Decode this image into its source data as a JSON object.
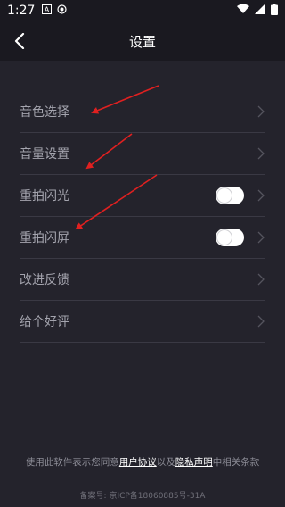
{
  "status_bar": {
    "time": "1:27",
    "left_icons": [
      "a-box-icon",
      "circle-dot-icon"
    ],
    "right_icons": [
      "wifi-icon",
      "signal-icon",
      "battery-icon"
    ]
  },
  "header": {
    "title": "设置"
  },
  "settings": {
    "items": [
      {
        "label": "音色选择",
        "toggle": null
      },
      {
        "label": "音量设置",
        "toggle": null
      },
      {
        "label": "重拍闪光",
        "toggle": false
      },
      {
        "label": "重拍闪屏",
        "toggle": false
      },
      {
        "label": "改进反馈",
        "toggle": null
      },
      {
        "label": "给个好评",
        "toggle": null
      }
    ]
  },
  "footer": {
    "agreement_prefix": "使用此软件表示您同意",
    "user_agreement": "用户协议",
    "agreement_middle": "以及",
    "privacy_policy": "隐私声明",
    "agreement_suffix": "中相关条款",
    "icp_label": "备案号:",
    "icp_number": "京ICP备18060885号-31A"
  },
  "colors": {
    "background": "#24232c",
    "header_background": "#1a1920",
    "annotation_arrow": "#e02020"
  }
}
